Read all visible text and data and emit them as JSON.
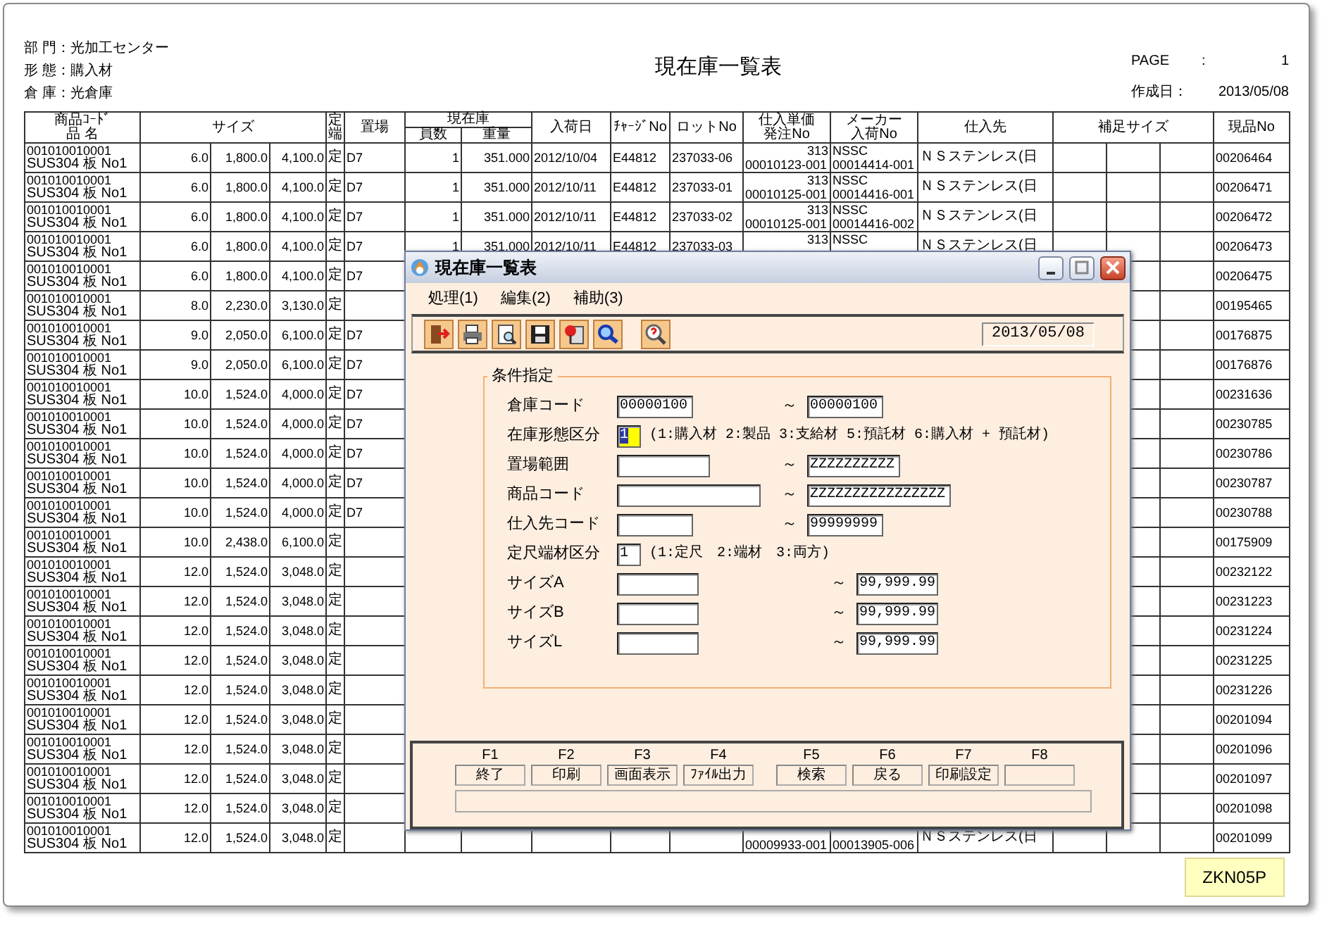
{
  "report": {
    "header_lines": [
      "部 門：光加工センター",
      "形 態：購入材",
      "倉 庫：光倉庫"
    ],
    "title": "現在庫一覧表",
    "page_label": "PAGE",
    "page_colon": ":",
    "page": "1",
    "created_label": "作成日：",
    "created": "2013/05/08"
  },
  "table": {
    "header": [
      {
        "lines": [
          "商品ｺｰﾄﾞ",
          "品 名"
        ]
      },
      {
        "lines": [
          "サイズ"
        ]
      },
      {
        "lines": [
          "定",
          "端"
        ]
      },
      {
        "lines": [
          "置場"
        ]
      },
      {
        "lines": [
          "現在庫"
        ],
        "sub": [
          "員数",
          "重量"
        ]
      },
      {
        "lines": [
          "入荷日"
        ]
      },
      {
        "lines": [
          "ﾁｬｰｼﾞNo"
        ]
      },
      {
        "lines": [
          "ロットNo"
        ]
      },
      {
        "lines": [
          "仕入単価",
          "発注No"
        ]
      },
      {
        "lines": [
          "メーカー",
          "入荷No"
        ]
      },
      {
        "lines": [
          "仕入先"
        ]
      },
      {
        "lines": [
          "補足サイズ"
        ]
      },
      {
        "lines": [
          "現品No"
        ]
      }
    ],
    "rows": [
      {
        "code": "001010010001",
        "name": "SUS304 板 No1",
        "size_a": "6.0",
        "size_b": "1,800.0",
        "size_c": "4,100.0",
        "form": "定",
        "location": "D7",
        "qty": "1",
        "weight": "351.000",
        "arrival": "2012/10/04",
        "charge": "E44812",
        "lot": "237033-06",
        "unit_price": "313",
        "order_no": "00010123-001",
        "maker": "NSSC",
        "maker_no": "00014414-001",
        "supplier": "ＮＳステンレス(日",
        "item_no": "00206464"
      },
      {
        "code": "001010010001",
        "name": "SUS304 板 No1",
        "size_a": "6.0",
        "size_b": "1,800.0",
        "size_c": "4,100.0",
        "form": "定",
        "location": "D7",
        "qty": "1",
        "weight": "351.000",
        "arrival": "2012/10/11",
        "charge": "E44812",
        "lot": "237033-01",
        "unit_price": "313",
        "order_no": "00010125-001",
        "maker": "NSSC",
        "maker_no": "00014416-001",
        "supplier": "ＮＳステンレス(日",
        "item_no": "00206471"
      },
      {
        "code": "001010010001",
        "name": "SUS304 板 No1",
        "size_a": "6.0",
        "size_b": "1,800.0",
        "size_c": "4,100.0",
        "form": "定",
        "location": "D7",
        "qty": "1",
        "weight": "351.000",
        "arrival": "2012/10/11",
        "charge": "E44812",
        "lot": "237033-02",
        "unit_price": "313",
        "order_no": "00010125-001",
        "maker": "NSSC",
        "maker_no": "00014416-002",
        "supplier": "ＮＳステンレス(日",
        "item_no": "00206472"
      },
      {
        "code": "001010010001",
        "name": "SUS304 板 No1",
        "size_a": "6.0",
        "size_b": "1,800.0",
        "size_c": "4,100.0",
        "form": "定",
        "location": "D7",
        "qty": "1",
        "weight": "351.000",
        "arrival": "2012/10/11",
        "charge": "E44812",
        "lot": "237033-03",
        "unit_price": "313",
        "maker": "NSSC",
        "supplier": "ＮＳステンレス(日",
        "item_no": "00206473"
      },
      {
        "code": "001010010001",
        "name": "SUS304 板 No1",
        "size_a": "6.0",
        "size_b": "1,800.0",
        "size_c": "4,100.0",
        "form": "定",
        "location": "D7",
        "item_no": "00206475"
      },
      {
        "code": "001010010001",
        "name": "SUS304 板 No1",
        "size_a": "8.0",
        "size_b": "2,230.0",
        "size_c": "3,130.0",
        "form": "定",
        "item_no": "00195465"
      },
      {
        "code": "001010010001",
        "name": "SUS304 板 No1",
        "size_a": "9.0",
        "size_b": "2,050.0",
        "size_c": "6,100.0",
        "form": "定",
        "location": "D7",
        "item_no": "00176875"
      },
      {
        "code": "001010010001",
        "name": "SUS304 板 No1",
        "size_a": "9.0",
        "size_b": "2,050.0",
        "size_c": "6,100.0",
        "form": "定",
        "location": "D7",
        "item_no": "00176876"
      },
      {
        "code": "001010010001",
        "name": "SUS304 板 No1",
        "size_a": "10.0",
        "size_b": "1,524.0",
        "size_c": "4,000.0",
        "form": "定",
        "location": "D7",
        "item_no": "00231636"
      },
      {
        "code": "001010010001",
        "name": "SUS304 板 No1",
        "size_a": "10.0",
        "size_b": "1,524.0",
        "size_c": "4,000.0",
        "form": "定",
        "location": "D7",
        "item_no": "00230785"
      },
      {
        "code": "001010010001",
        "name": "SUS304 板 No1",
        "size_a": "10.0",
        "size_b": "1,524.0",
        "size_c": "4,000.0",
        "form": "定",
        "location": "D7",
        "item_no": "00230786"
      },
      {
        "code": "001010010001",
        "name": "SUS304 板 No1",
        "size_a": "10.0",
        "size_b": "1,524.0",
        "size_c": "4,000.0",
        "form": "定",
        "location": "D7",
        "item_no": "00230787"
      },
      {
        "code": "001010010001",
        "name": "SUS304 板 No1",
        "size_a": "10.0",
        "size_b": "1,524.0",
        "size_c": "4,000.0",
        "form": "定",
        "location": "D7",
        "item_no": "00230788"
      },
      {
        "code": "001010010001",
        "name": "SUS304 板 No1",
        "size_a": "10.0",
        "size_b": "2,438.0",
        "size_c": "6,100.0",
        "form": "定",
        "item_no": "00175909"
      },
      {
        "code": "001010010001",
        "name": "SUS304 板 No1",
        "size_a": "12.0",
        "size_b": "1,524.0",
        "size_c": "3,048.0",
        "form": "定",
        "item_no": "00232122"
      },
      {
        "code": "001010010001",
        "name": "SUS304 板 No1",
        "size_a": "12.0",
        "size_b": "1,524.0",
        "size_c": "3,048.0",
        "form": "定",
        "item_no": "00231223"
      },
      {
        "code": "001010010001",
        "name": "SUS304 板 No1",
        "size_a": "12.0",
        "size_b": "1,524.0",
        "size_c": "3,048.0",
        "form": "定",
        "item_no": "00231224"
      },
      {
        "code": "001010010001",
        "name": "SUS304 板 No1",
        "size_a": "12.0",
        "size_b": "1,524.0",
        "size_c": "3,048.0",
        "form": "定",
        "item_no": "00231225"
      },
      {
        "code": "001010010001",
        "name": "SUS304 板 No1",
        "size_a": "12.0",
        "size_b": "1,524.0",
        "size_c": "3,048.0",
        "form": "定",
        "item_no": "00231226"
      },
      {
        "code": "001010010001",
        "name": "SUS304 板 No1",
        "size_a": "12.0",
        "size_b": "1,524.0",
        "size_c": "3,048.0",
        "form": "定",
        "item_no": "00201094"
      },
      {
        "code": "001010010001",
        "name": "SUS304 板 No1",
        "size_a": "12.0",
        "size_b": "1,524.0",
        "size_c": "3,048.0",
        "form": "定",
        "item_no": "00201096"
      },
      {
        "code": "001010010001",
        "name": "SUS304 板 No1",
        "size_a": "12.0",
        "size_b": "1,524.0",
        "size_c": "3,048.0",
        "form": "定",
        "item_no": "00201097"
      },
      {
        "code": "001010010001",
        "name": "SUS304 板 No1",
        "size_a": "12.0",
        "size_b": "1,524.0",
        "size_c": "3,048.0",
        "form": "定",
        "item_no": "00201098"
      },
      {
        "code": "001010010001",
        "name": "SUS304 板 No1",
        "size_a": "12.0",
        "size_b": "1,524.0",
        "size_c": "3,048.0",
        "form": "定",
        "order_no": "00009933-001",
        "maker_no": "00013905-006",
        "supplier": "ＮＳステンレス(日",
        "item_no": "00201099"
      }
    ]
  },
  "dialog": {
    "title": "現在庫一覧表",
    "menu": [
      "処理(1)",
      "編集(2)",
      "補助(3)"
    ],
    "date": "2013/05/08",
    "form": {
      "legend": "条件指定",
      "rows": [
        {
          "kind": "range",
          "label": "倉庫コード",
          "from": {
            "value": "00000100"
          },
          "tilde": "～",
          "to": {
            "value": "00000100"
          }
        },
        {
          "kind": "choice",
          "label": "在庫形態区分",
          "from": {
            "value": "1",
            "focused": true
          },
          "note": "(1:購入材 2:製品 3:支給材 5:預託材 6:購入材 + 預託材)"
        },
        {
          "kind": "range",
          "label": "置場範囲",
          "from": {},
          "tilde": "～",
          "to": {
            "value": "ZZZZZZZZZZ"
          }
        },
        {
          "kind": "range",
          "label": "商品コード",
          "from": {},
          "tilde": "～",
          "to": {
            "value": "ZZZZZZZZZZZZZZZZ"
          }
        },
        {
          "kind": "range",
          "label": "仕入先コード",
          "from": {},
          "tilde": "～",
          "to": {
            "value": "99999999"
          }
        },
        {
          "kind": "choice",
          "label": "定尺端材区分",
          "from": {
            "value": "1",
            "focused": false
          },
          "note": "(1:定尺　2:端材　3:両方)"
        },
        {
          "kind": "size",
          "label": "サイズA",
          "from": {},
          "tilde": "～",
          "to": {
            "value": "99,999.99"
          }
        },
        {
          "kind": "size",
          "label": "サイズB",
          "from": {},
          "tilde": "～",
          "to": {
            "value": "99,999.99"
          }
        },
        {
          "kind": "size",
          "label": "サイズL",
          "from": {},
          "tilde": "～",
          "to": {
            "value": "99,999.99"
          }
        }
      ]
    },
    "function_keys": [
      {
        "key": "F1",
        "label": "終了"
      },
      {
        "key": "F2",
        "label": "印刷"
      },
      {
        "key": "F3",
        "label": "画面表示"
      },
      {
        "key": "F4",
        "label": "ﾌｧｲﾙ出力"
      },
      {
        "key": "F5",
        "label": "検索"
      },
      {
        "key": "F6",
        "label": "戻る"
      },
      {
        "key": "F7",
        "label": "印刷設定"
      },
      {
        "key": "F8"
      }
    ]
  },
  "report_code": "ZKN05P"
}
